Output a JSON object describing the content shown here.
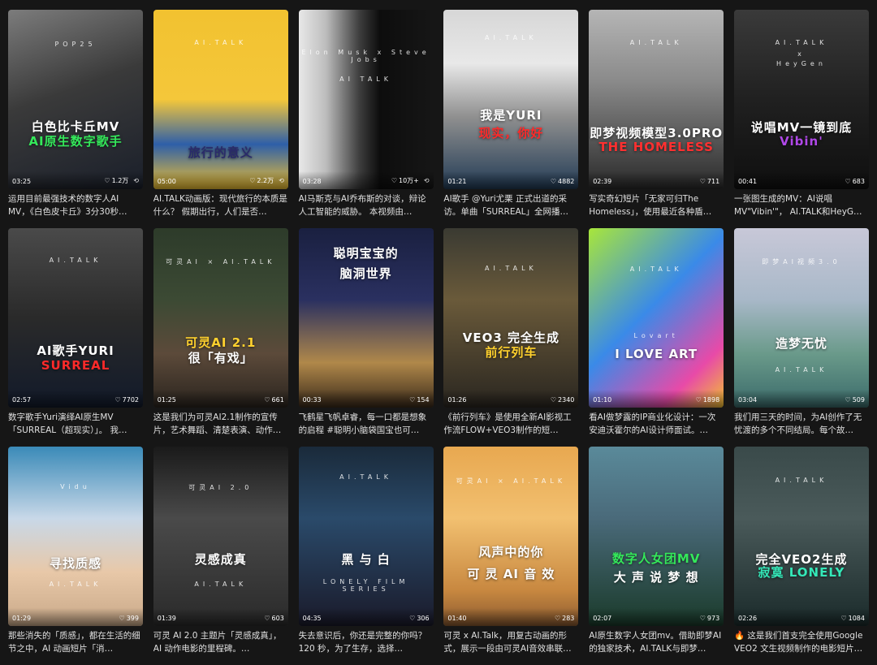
{
  "videos": [
    {
      "duration": "03:25",
      "likes": "1.2万",
      "extra": "⟲",
      "brand": "POP25",
      "title1": "白色比卡丘MV",
      "title2": "AI原生数字歌手",
      "title1_color": "#ffffff",
      "title2_color": "#34e85a",
      "bg": "linear-gradient(160deg,#7c7c7c 0%,#3a3a3a 45%,#1a1f2a 100%)",
      "desc": "运用目前最强技术的数字人AI MV，《白色皮卡丘》3分30秒…"
    },
    {
      "duration": "05:00",
      "likes": "2.2万",
      "extra": "⟲",
      "brand": "AI.TALK",
      "title1": "",
      "title2": "旅行的意义",
      "title1_color": "#ffffff",
      "title2_color": "#2a2a6a",
      "bg": "linear-gradient(180deg,#f2c230 0%,#f4c73a 50%,#2e5fa8 75%,#f1c232 100%)",
      "desc": "AI.TALK动画版：现代旅行的本质是什么？ 假期出行，人们是否…"
    },
    {
      "duration": "03:28",
      "likes": "10万+",
      "extra": "⟲",
      "brand": "Elon Musk x Steve Jobs",
      "brand2": "AI TALK",
      "title1": "",
      "title2": "",
      "title1_color": "#ffffff",
      "title2_color": "#ffffff",
      "bg": "linear-gradient(90deg,#e8e8e8 0%,#bdbdbd 20%,#3d3d3d 45%,#0d0d0d 60%,#161616 100%)",
      "desc": "AI马斯克与AI乔布斯的对谈，辩论人工智能的威胁。 本视频由…"
    },
    {
      "duration": "01:21",
      "likes": "4882",
      "extra": "",
      "brand": "AI.TALK",
      "title1": "我是YURI",
      "title2": "现实，你好",
      "title1_color": "#ffffff",
      "title2_color": "#ff2a2a",
      "bg": "linear-gradient(180deg,#d7d7d7 0%,#e8e8e8 30%,#8f8f8f 60%,#223b55 100%)",
      "desc": "AI歌手 @Yuri尤栗 正式出道的采访。单曲「SURREAL」全网播…"
    },
    {
      "duration": "02:39",
      "likes": "711",
      "extra": "",
      "brand": "AI.TALK",
      "title1": "即梦视频模型3.0PRO",
      "title2": "THE HOMELESS",
      "title1_color": "#ffffff",
      "title2_color": "#ff3030",
      "bg": "linear-gradient(180deg,#b5b5b5 0%,#8a8a8a 40%,#2a2a2a 100%)",
      "desc": "写实奇幻短片「无家可归The Homeless」，使用最近各种盾…"
    },
    {
      "duration": "00:41",
      "likes": "683",
      "extra": "",
      "brand": "AI.TALK",
      "brand2": "x",
      "brand3": "HeyGen",
      "title1": "说唱MV一镜到底",
      "title2": "Vibin'",
      "title1_color": "#ffffff",
      "title2_color": "#b048e8",
      "bg": "linear-gradient(180deg,#3a3a3a 0%,#202020 50%,#0f0f0f 100%)",
      "desc": "一张图生成的MV：AI说唱MV\"Vibin'\"， AI.TALK和HeyG…"
    },
    {
      "duration": "02:57",
      "likes": "7702",
      "extra": "",
      "brand": "AI.TALK",
      "title1": "AI歌手YURI",
      "title2": "SURREAL",
      "title1_color": "#ffffff",
      "title2_color": "#ff2a2a",
      "bg": "linear-gradient(180deg,#4a4a4a 0%,#2a2a2a 50%,#121a2a 100%)",
      "desc": "数字歌手Yuri演绎AI原生MV 「SURREAL（超现实）」。 我…"
    },
    {
      "duration": "01:25",
      "likes": "661",
      "extra": "",
      "brand": "可灵AI × AI.TALK",
      "title1": "可灵AI 2.1",
      "title2": "很「有戏」",
      "title1_color": "#ffd12e",
      "title2_color": "#ffffff",
      "bg": "linear-gradient(180deg,#2d3b2a 0%,#3c4a34 40%,#5c4a3a 70%,#2a241e 100%)",
      "desc": "这是我们为可灵AI2.1制作的宣传片，艺术舞蹈、清楚表演、动作…"
    },
    {
      "duration": "00:33",
      "likes": "154",
      "extra": "",
      "brand": "",
      "title1": "聪明宝宝的",
      "title2": "脑洞世界",
      "title1_color": "#ffffff",
      "title2_color": "#ffffff",
      "bg": "linear-gradient(180deg,#1a2040 0%,#2a3060 40%,#b0884a 75%,#3a2a1a 100%)",
      "desc": "飞鹤星飞帆卓睿，每一口都是想象的启程 #聪明小脑袋国宝也可…"
    },
    {
      "duration": "01:26",
      "likes": "2340",
      "extra": "",
      "brand": "AI.TALK",
      "title1": "VEO3 完全生成",
      "title2": "前行列车",
      "title1_color": "#ffffff",
      "title2_color": "#ffd12e",
      "bg": "linear-gradient(180deg,#3a3a32 0%,#6a5a3a 40%,#2a2620 100%)",
      "desc": "《前行列车》是使用全新AI影视工作流FLOW+VEO3制作的短…"
    },
    {
      "duration": "01:10",
      "likes": "1898",
      "extra": "",
      "brand": "AI.TALK",
      "brand2": "Lovart",
      "title1": "",
      "title2": "I LOVE ART",
      "title1_color": "#ffffff",
      "title2_color": "#ffffff",
      "bg": "linear-gradient(135deg,#a8e63a 0%,#3a8ae8 45%,#e84aa8 80%,#f2c230 100%)",
      "desc": "看AI做梦露的IP商业化设计：一次安迪沃霍尔的AI设计师面试。…"
    },
    {
      "duration": "03:04",
      "likes": "509",
      "extra": "",
      "brand": "即梦AI视频3.0",
      "title1": "",
      "title2": "造梦无忧",
      "brand2": "AI.TALK",
      "title1_color": "#ffffff",
      "title2_color": "#ffffff",
      "bg": "linear-gradient(180deg,#c8c8d8 0%,#a8b8c8 40%,#6a9a8a 70%,#3a6a6a 100%)",
      "desc": "我们用三天的时间，为AI创作了无忧渡的多个不同结局。每个故…"
    },
    {
      "duration": "01:29",
      "likes": "399",
      "extra": "",
      "brand": "Vidu",
      "title1": "",
      "title2": "寻找质感",
      "brand2": "AI.TALK",
      "title1_color": "#ffffff",
      "title2_color": "#ffffff",
      "bg": "linear-gradient(180deg,#3a8ab8 0%,#c8d8e8 40%,#e8c8a8 70%,#c8a888 100%)",
      "desc": "那些消失的「质感」，都在生活的细节之中，AI 动画短片「消…"
    },
    {
      "duration": "01:39",
      "likes": "603",
      "extra": "",
      "brand": "可灵AI 2.0",
      "title1": "",
      "title2": "灵感成真",
      "brand2": "AI.TALK",
      "title1_color": "#ffffff",
      "title2_color": "#ffffff",
      "bg": "linear-gradient(180deg,#1a1a1a 0%,#4a4a4a 40%,#2a2a2a 100%)",
      "desc": "可灵 AI 2.0 主题片「灵感成真」，AI 动作电影的里程碑。…"
    },
    {
      "duration": "04:35",
      "likes": "306",
      "extra": "",
      "brand": "AI.TALK",
      "title1": "",
      "title2": "黑 与 白",
      "brand2": "LONELY FILM SERIES",
      "title1_color": "#ffffff",
      "title2_color": "#ffffff",
      "bg": "linear-gradient(180deg,#1a2a3a 0%,#2a4a6a 40%,#1a1a2a 100%)",
      "desc": "失去意识后，你还是完整的你吗？ 120 秒，为了生存，选择…"
    },
    {
      "duration": "01:40",
      "likes": "283",
      "extra": "",
      "brand": "可灵AI × AI.TALK",
      "title1": "风声中的你",
      "title2": "可 灵 AI 音 效",
      "title1_color": "#ffffff",
      "title2_color": "#ffffff",
      "bg": "linear-gradient(180deg,#e8a850 0%,#f2c070 40%,#c88840 80%,#8a5a30 100%)",
      "desc": "可灵 x AI.Talk，用复古动画的形式，展示一段由可灵AI音效串联…"
    },
    {
      "duration": "02:07",
      "likes": "973",
      "extra": "",
      "brand": "",
      "title1": "数字人女团MV",
      "title2": "大 声 说 梦 想",
      "title1_color": "#34e85a",
      "title2_color": "#ffffff",
      "bg": "linear-gradient(180deg,#5a8a9a 0%,#4a6a7a 40%,#1a3a2a 100%)",
      "desc": "AI原生数字人女团mv。借助即梦AI的独家技术，AI.TALK与即梦…"
    },
    {
      "duration": "02:26",
      "likes": "1084",
      "extra": "",
      "brand": "AI.TALK",
      "title1": "完全VEO2生成",
      "title2": "寂寞 LONELY",
      "title1_color": "#ffffff",
      "title2_color": "#34e8b8",
      "bg": "linear-gradient(180deg,#3a4a4a 0%,#4a5a5a 40%,#1a2a2a 100%)",
      "desc": "🔥 这是我们首支完全使用Google VEO2 文生视频制作的电影短片…"
    }
  ]
}
